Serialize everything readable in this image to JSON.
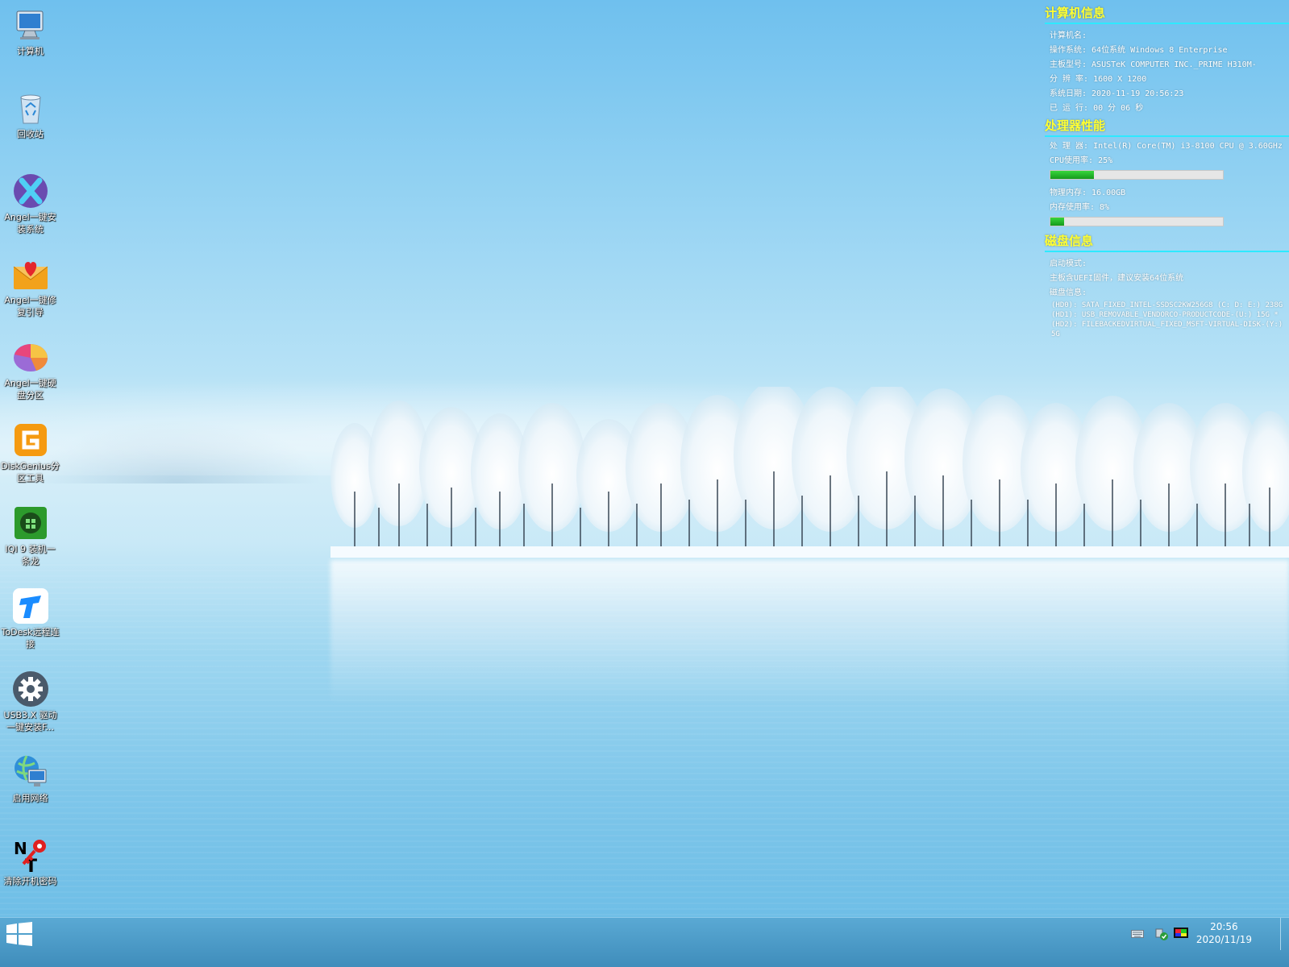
{
  "desktop_icons": [
    {
      "label": "计算机",
      "icon": "computer-icon"
    },
    {
      "label": "回收站",
      "icon": "recycle-bin-icon"
    },
    {
      "label": "Angel一键安装系统",
      "icon": "angel-install-icon"
    },
    {
      "label": "Angel一键修复引导",
      "icon": "angel-repair-boot-icon"
    },
    {
      "label": "Angel一键硬盘分区",
      "icon": "angel-partition-icon"
    },
    {
      "label": "DiskGenius分区工具",
      "icon": "diskgenius-icon"
    },
    {
      "label": "IQI 9 装机一条龙",
      "icon": "iqi9-icon"
    },
    {
      "label": "ToDesk远程连接",
      "icon": "todesk-icon"
    },
    {
      "label": "USB3.X 驱动一键安装F...",
      "icon": "usb-driver-gear-icon"
    },
    {
      "label": "启用网络",
      "icon": "enable-network-icon"
    },
    {
      "label": "清除开机密码",
      "icon": "clear-password-key-icon"
    }
  ],
  "panel": {
    "computer": {
      "title": "计算机信息",
      "name": "计算机名:",
      "os": "操作系统: 64位系统  Windows 8 Enterprise",
      "board": "主板型号:  ASUSTeK COMPUTER INC._PRIME H310M-",
      "resolution": "分 辨 率: 1600 X 1200",
      "date": "系统日期: 2020-11-19     20:56:23",
      "uptime": "已 运 行: 00 分 06 秒"
    },
    "cpu": {
      "title": "处理器性能",
      "processor": "处 理 器: Intel(R) Core(TM) i3-8100 CPU @ 3.60GHz",
      "cpu_usage_label": "CPU使用率:    25%",
      "cpu_usage": 0.25,
      "memory": "物理内存: 16.00GB",
      "mem_usage_label": "内存使用率:   8%",
      "mem_usage": 0.08
    },
    "disk": {
      "title": "磁盘信息",
      "boot_mode": "启动模式:",
      "uefi_hint": "主板含UEFI固件，建议安装64位系统",
      "disk_info": "磁盘信息:",
      "hd0": "(HD0): SATA_FIXED_INTEL-SSDSC2KW256G8 (C: D: E:) 238G",
      "hd1": "(HD1): USB_REMOVABLE_VENDORCO-PRODUCTCODE-(U:) 15G *",
      "hd2": "(HD2): FILEBACKEDVIRTUAL_FIXED_MSFT-VIRTUAL-DISK-(Y:) 5G"
    }
  },
  "taskbar": {
    "time": "20:56",
    "date": "2020/11/19"
  },
  "colors": {
    "section_title": "#ffff33",
    "section_rule": "#2ee9ff",
    "taskbar": "#4a9ac8"
  }
}
